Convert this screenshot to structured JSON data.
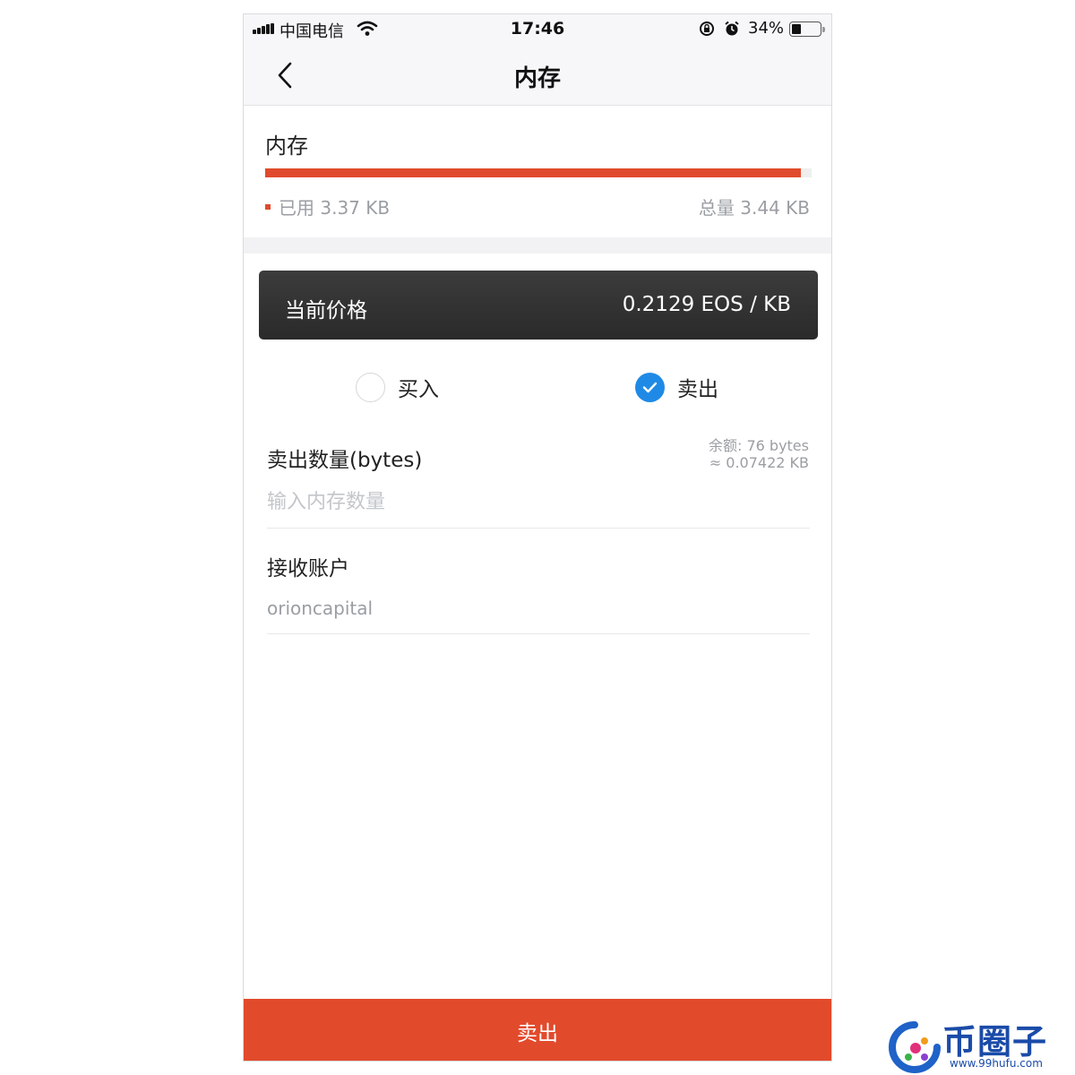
{
  "status_bar": {
    "carrier": "中国电信",
    "time": "17:46",
    "battery": "34%",
    "battery_level_percent": 34
  },
  "nav": {
    "title": "内存",
    "back_icon": "chevron-left-icon"
  },
  "memory": {
    "title": "内存",
    "used_label": "已用 3.37 KB",
    "total_label": "总量 3.44 KB",
    "used_kb": 3.37,
    "total_kb": 3.44,
    "bar_color": "#e04a2d"
  },
  "price": {
    "label": "当前价格",
    "value": "0.2129 EOS / KB"
  },
  "mode": {
    "buy_label": "买入",
    "sell_label": "卖出",
    "selected": "sell",
    "accent_color": "#1f8ae6"
  },
  "sell_amount": {
    "label": "卖出数量(bytes)",
    "balance_line1": "余额: 76 bytes",
    "balance_line2": "≈ 0.07422 KB",
    "placeholder": "输入内存数量"
  },
  "receiver": {
    "label": "接收账户",
    "value": "orioncapital"
  },
  "submit": {
    "label": "卖出",
    "color": "#e24a2c"
  },
  "watermark": {
    "text": "币圈子",
    "url": "www.99hufu.com"
  }
}
